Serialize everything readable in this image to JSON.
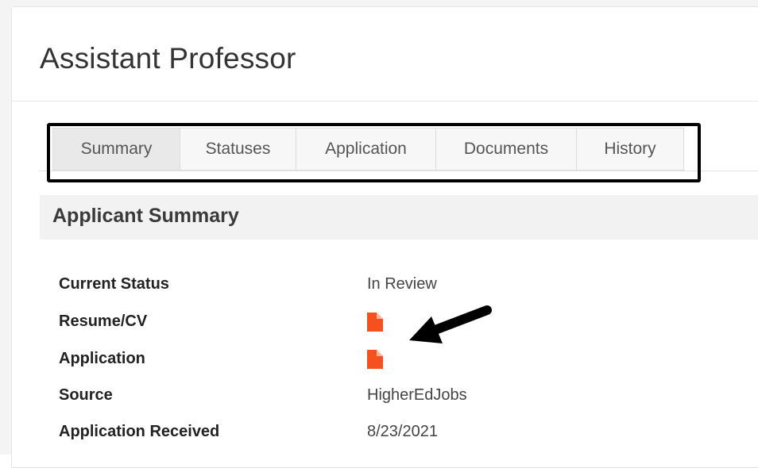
{
  "page": {
    "title": "Assistant Professor"
  },
  "tabs": [
    {
      "label": "Summary",
      "active": true
    },
    {
      "label": "Statuses",
      "active": false
    },
    {
      "label": "Application",
      "active": false
    },
    {
      "label": "Documents",
      "active": false
    },
    {
      "label": "History",
      "active": false
    }
  ],
  "summary": {
    "heading": "Applicant Summary",
    "rows": [
      {
        "label": "Current Status",
        "value": "In Review"
      },
      {
        "label": "Resume/CV",
        "icon": "document-icon"
      },
      {
        "label": "Application",
        "icon": "document-icon"
      },
      {
        "label": "Source",
        "value": "HigherEdJobs"
      },
      {
        "label": "Application Received",
        "value": "8/23/2021"
      }
    ]
  },
  "colors": {
    "document_icon": "#f4511e",
    "annotation": "#000000"
  }
}
